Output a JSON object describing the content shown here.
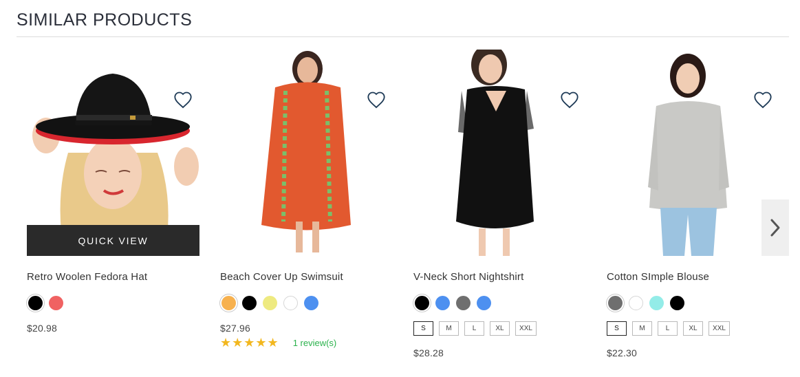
{
  "section": {
    "title": "SIMILAR PRODUCTS"
  },
  "quick_view_label": "QUICK VIEW",
  "products": [
    {
      "name": "Retro Woolen Fedora Hat",
      "price": "$20.98",
      "swatches": [
        {
          "color": "#000000",
          "selected": true
        },
        {
          "color": "#f06262",
          "selected": false
        }
      ],
      "sizes": [],
      "rating": null,
      "image": "woman-wearing-black-fedora-hat"
    },
    {
      "name": "Beach Cover Up Swimsuit",
      "price": "$27.96",
      "swatches": [
        {
          "color": "#f7b14e",
          "selected": true
        },
        {
          "color": "#000000",
          "selected": false
        },
        {
          "color": "#eeea80",
          "selected": false
        },
        {
          "color": "#ffffff",
          "selected": false
        },
        {
          "color": "#4d90f0",
          "selected": false
        }
      ],
      "sizes": [],
      "rating": {
        "stars": "★★★★★",
        "reviews": "1 review(s)",
        "value": 5
      },
      "image": "woman-in-orange-beach-cover-up"
    },
    {
      "name": "V-Neck Short Nightshirt",
      "price": "$28.28",
      "swatches": [
        {
          "color": "#000000",
          "selected": true
        },
        {
          "color": "#4d90f0",
          "selected": false
        },
        {
          "color": "#6f6f6f",
          "selected": false
        },
        {
          "color": "#4d90f0",
          "selected": false
        }
      ],
      "sizes": [
        {
          "label": "S",
          "active": true
        },
        {
          "label": "M",
          "active": false
        },
        {
          "label": "L",
          "active": false
        },
        {
          "label": "XL",
          "active": false
        },
        {
          "label": "XXL",
          "active": false
        }
      ],
      "rating": null,
      "image": "woman-in-black-nightshirt"
    },
    {
      "name": "Cotton SImple Blouse",
      "price": "$22.30",
      "swatches": [
        {
          "color": "#6f6f6f",
          "selected": true
        },
        {
          "color": "#ffffff",
          "selected": false
        },
        {
          "color": "#93ece8",
          "selected": false
        },
        {
          "color": "#000000",
          "selected": false
        }
      ],
      "sizes": [
        {
          "label": "S",
          "active": true
        },
        {
          "label": "M",
          "active": false
        },
        {
          "label": "L",
          "active": false
        },
        {
          "label": "XL",
          "active": false
        },
        {
          "label": "XXL",
          "active": false
        }
      ],
      "rating": null,
      "image": "woman-in-grey-blouse"
    }
  ],
  "icons": {
    "wishlist": "heart-outline-icon",
    "next": "chevron-right-icon"
  },
  "colors": {
    "accent_text": "#2b2f3a",
    "quick_view_bg": "#2a2a2a",
    "star": "#f2b71f",
    "review_link": "#2bb24c"
  }
}
